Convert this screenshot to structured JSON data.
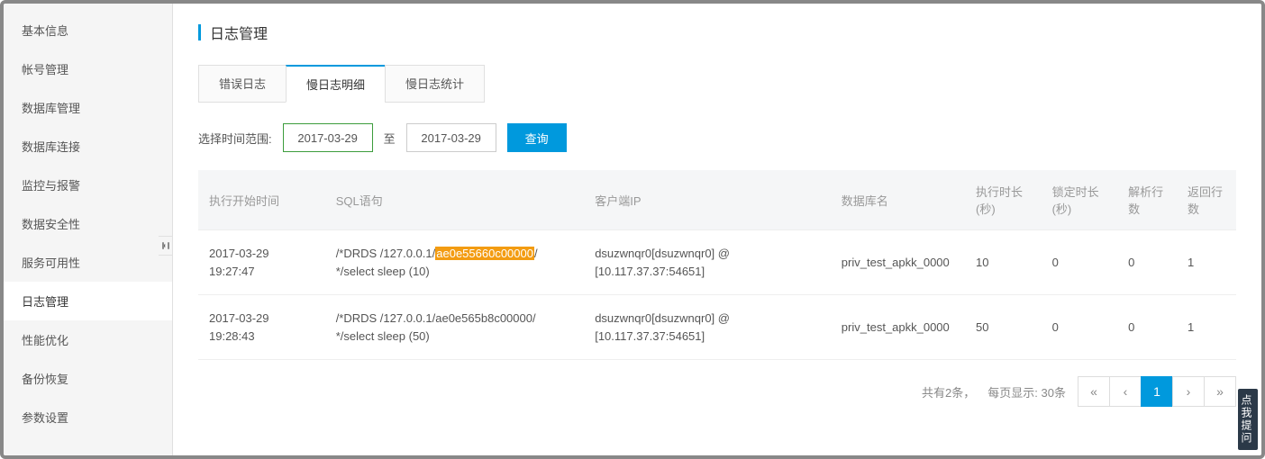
{
  "sidebar": {
    "items": [
      {
        "label": "基本信息"
      },
      {
        "label": "帐号管理"
      },
      {
        "label": "数据库管理"
      },
      {
        "label": "数据库连接"
      },
      {
        "label": "监控与报警"
      },
      {
        "label": "数据安全性"
      },
      {
        "label": "服务可用性"
      },
      {
        "label": "日志管理",
        "active": true
      },
      {
        "label": "性能优化"
      },
      {
        "label": "备份恢复"
      },
      {
        "label": "参数设置"
      }
    ]
  },
  "page_title": "日志管理",
  "tabs": [
    {
      "label": "错误日志"
    },
    {
      "label": "慢日志明细",
      "active": true
    },
    {
      "label": "慢日志统计"
    }
  ],
  "filters": {
    "range_label": "选择时间范围:",
    "from": "2017-03-29",
    "to_label": "至",
    "to": "2017-03-29",
    "query_btn": "查询"
  },
  "table": {
    "columns": [
      "执行开始时间",
      "SQL语句",
      "客户端IP",
      "数据库名",
      "执行时长(秒)",
      "锁定时长(秒)",
      "解析行数",
      "返回行数"
    ],
    "rows": [
      {
        "start": "2017-03-29 19:27:47",
        "sql_pre": "/*DRDS /127.0.0.1/",
        "sql_hl": "ae0e55660c00000",
        "sql_post": "/ */select sleep (10)",
        "client": "dsuzwnqr0[dsuzwnqr0] @ [10.117.37.37:54651]",
        "db": "priv_test_apkk_0000",
        "exec": "10",
        "lock": "0",
        "parse": "0",
        "ret": "1"
      },
      {
        "start": "2017-03-29 19:28:43",
        "sql_pre": "/*DRDS /127.0.0.1/ae0e565b8c00000/ */select sleep (50)",
        "sql_hl": "",
        "sql_post": "",
        "client": "dsuzwnqr0[dsuzwnqr0] @ [10.117.37.37:54651]",
        "db": "priv_test_apkk_0000",
        "exec": "50",
        "lock": "0",
        "parse": "0",
        "ret": "1"
      }
    ]
  },
  "footer": {
    "total": "共有2条，",
    "page_size_label": "每页显示:",
    "page_size": "30条",
    "pages": [
      "«",
      "‹",
      "1",
      "›",
      "»"
    ],
    "active_page": "1"
  },
  "feedback": "点我提问"
}
